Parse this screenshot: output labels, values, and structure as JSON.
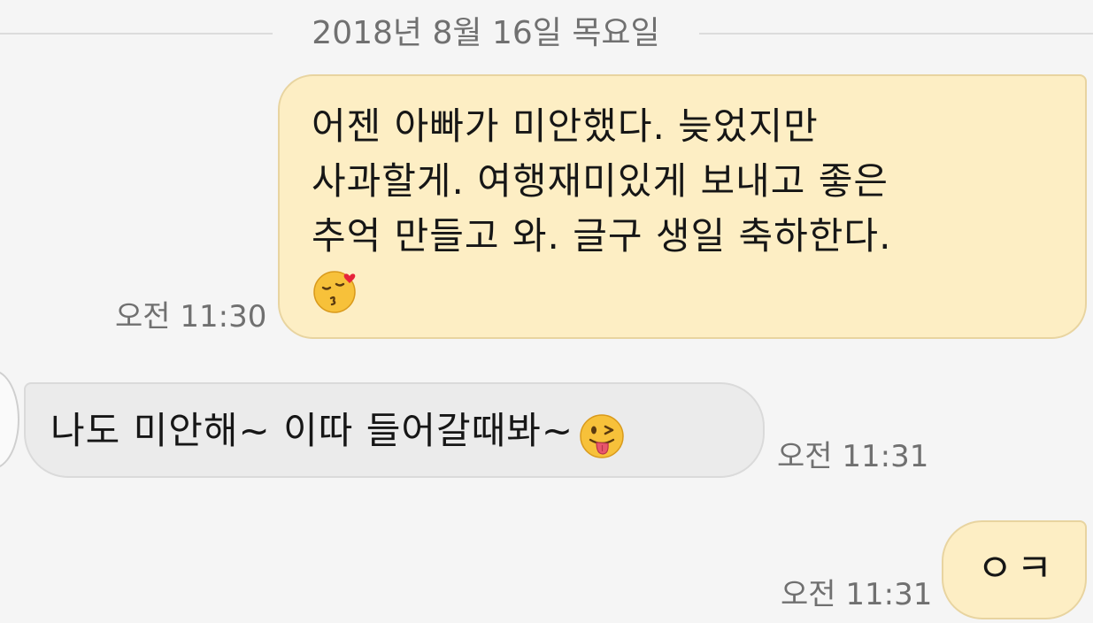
{
  "date_divider": {
    "text": "2018년 8월 16일 목요일"
  },
  "messages": [
    {
      "direction": "sent",
      "text": "어젠 아빠가 미안했다. 늦었지만\n사과할게. 여행재미있게 보내고 좋은\n추억 만들고 와. 글구 생일 축하한다.",
      "emoji": "kissing-face-with-closed-eyes-and-heart",
      "time": "오전 11:30"
    },
    {
      "direction": "received",
      "text": "나도 미안해~ 이따 들어갈때봐~",
      "emoji": "winking-face-with-tongue",
      "time": "오전 11:31"
    },
    {
      "direction": "sent",
      "text": "ㅇㅋ",
      "time": "오전 11:31"
    }
  ],
  "colors": {
    "background": "#f5f5f5",
    "sent_bubble": "#fdeec4",
    "sent_border": "#e8d4a0",
    "received_bubble": "#ebebeb",
    "timestamp": "#707070",
    "emoji_yellow": "#f7c13a"
  }
}
